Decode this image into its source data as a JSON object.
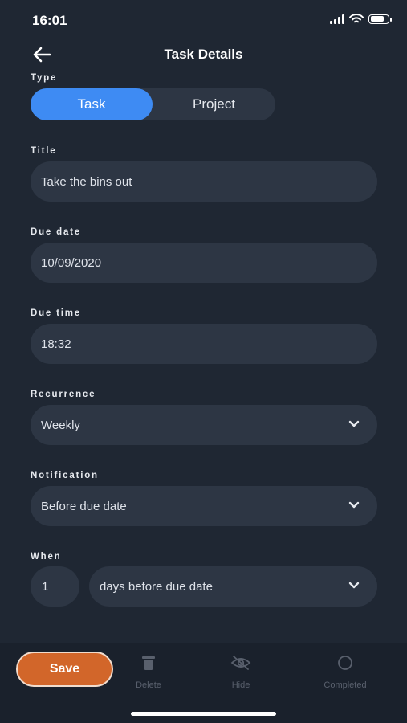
{
  "status_bar": {
    "time": "16:01"
  },
  "header": {
    "title": "Task Details"
  },
  "type_selector": {
    "label": "Type",
    "options": [
      "Task",
      "Project"
    ],
    "selected": "Task"
  },
  "form": {
    "title": {
      "label": "Title",
      "value": "Take the bins out"
    },
    "due_date": {
      "label": "Due date",
      "value": "10/09/2020"
    },
    "due_time": {
      "label": "Due time",
      "value": "18:32"
    },
    "recurrence": {
      "label": "Recurrence",
      "value": "Weekly"
    },
    "notification": {
      "label": "Notification",
      "value": "Before due date"
    },
    "when": {
      "label": "When",
      "amount": "1",
      "unit": "days before due date"
    }
  },
  "bottom_bar": {
    "save_label": "Save",
    "actions": [
      "Delete",
      "Hide",
      "Completed"
    ]
  },
  "icons": {
    "back": "arrow-left-icon",
    "chevron": "chevron-down-icon",
    "delete": "trash-icon",
    "hide": "eye-slash-icon",
    "completed": "circle-icon"
  },
  "colors": {
    "background": "#1f2733",
    "field": "#2d3644",
    "accent": "#3e8bf3",
    "save": "#d2662a",
    "bottom_bar": "#1a212c"
  }
}
